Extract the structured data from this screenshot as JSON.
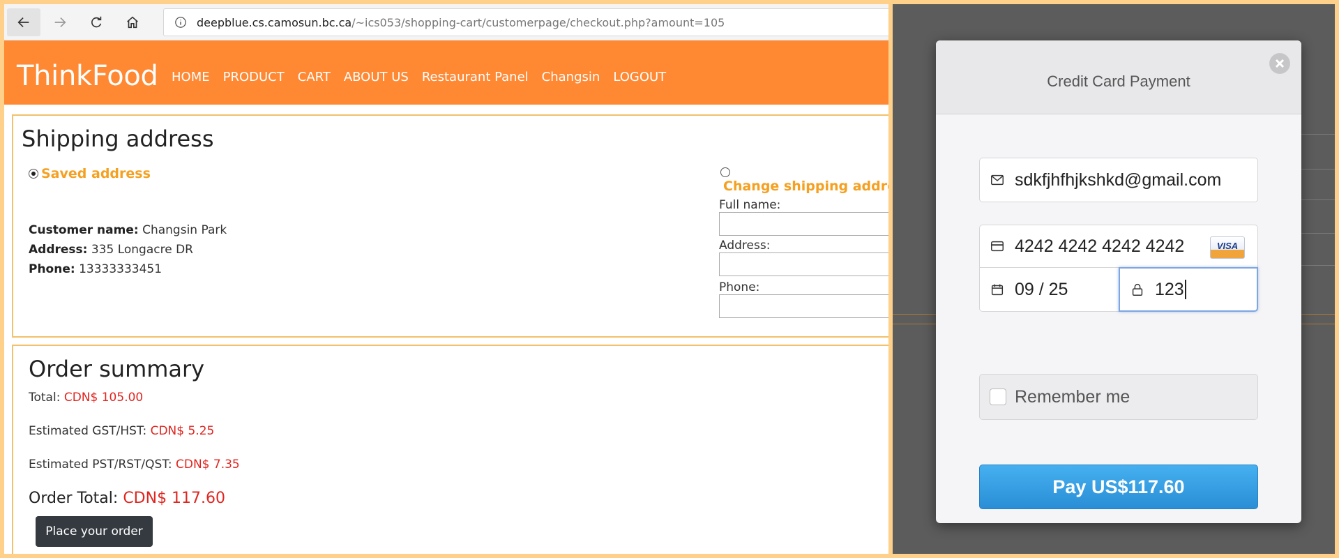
{
  "browser": {
    "url_host": "deepblue.cs.camosun.bc.ca",
    "url_path": "/~ics053/shopping-cart/customerpage/checkout.php?amount=105"
  },
  "site": {
    "brand": "ThinkFood",
    "nav": [
      "HOME",
      "PRODUCT",
      "CART",
      "ABOUT US",
      "Restaurant Panel",
      "Changsin",
      "LOGOUT"
    ],
    "accent_color": "#ff8833"
  },
  "shipping": {
    "title": "Shipping address",
    "saved_label": "Saved address",
    "change_label": "Change shipping address",
    "customer_label": "Customer name:",
    "customer_value": "Changsin Park",
    "address_label": "Address:",
    "address_value": "335 Longacre DR",
    "phone_label": "Phone:",
    "phone_value": "13333333451",
    "form": {
      "full_name_label": "Full name:",
      "address_label": "Address:",
      "phone_label": "Phone:"
    }
  },
  "order": {
    "title": "Order summary",
    "total_label": "Total:",
    "total_value": "CDN$ 105.00",
    "gst_label": "Estimated GST/HST:",
    "gst_value": "CDN$ 5.25",
    "pst_label": "Estimated PST/RST/QST:",
    "pst_value": "CDN$ 7.35",
    "order_total_label": "Order Total:",
    "order_total_value": "CDN$ 117.60",
    "place_button": "Place your order"
  },
  "modal": {
    "title": "Credit Card Payment",
    "email": "sdkfjhfhjkshkd@gmail.com",
    "card_number": "4242 4242 4242 4242",
    "card_brand": "VISA",
    "expiry": "09 / 25",
    "cvc": "123",
    "remember_label": "Remember me",
    "remember_checked": false,
    "pay_button": "Pay US$117.60",
    "pay_color": "#2a8ed6"
  },
  "icons": [
    "back-icon",
    "forward-icon",
    "reload-icon",
    "home-icon",
    "info-icon",
    "close-icon",
    "mail-icon",
    "card-icon",
    "calendar-icon",
    "lock-icon"
  ]
}
